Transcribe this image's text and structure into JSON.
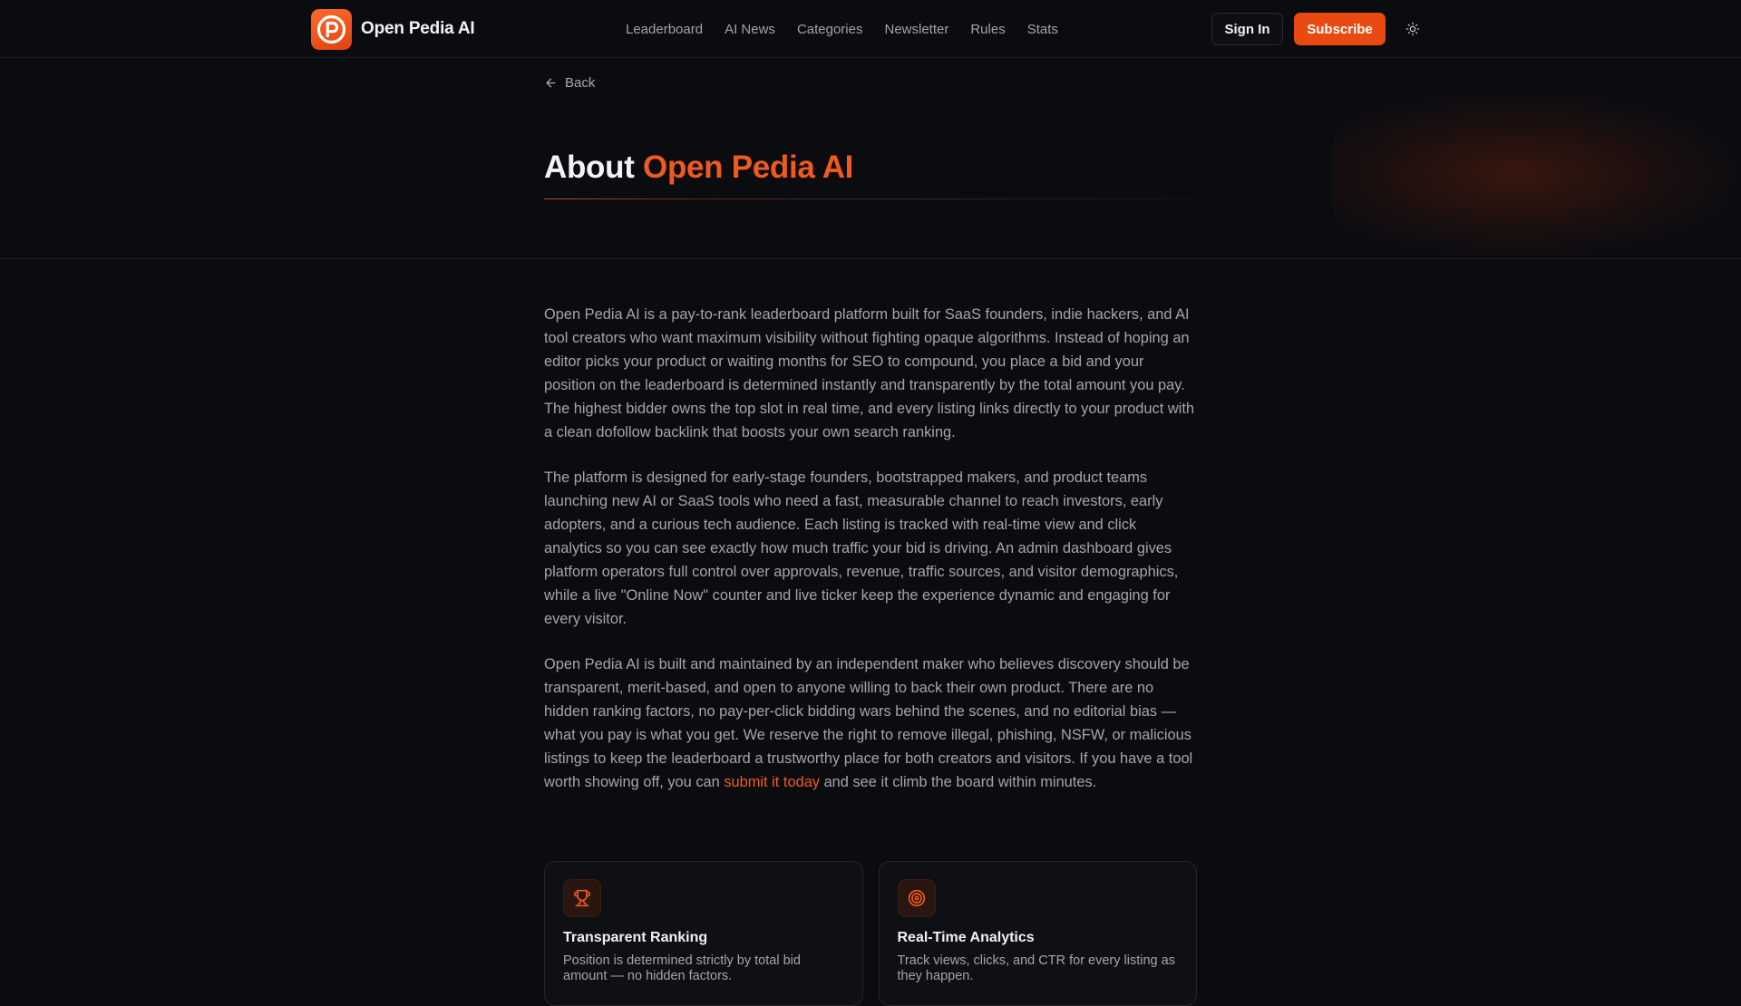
{
  "header": {
    "brand_name": "Open Pedia AI",
    "nav": [
      "Leaderboard",
      "AI News",
      "Categories",
      "Newsletter",
      "Rules",
      "Stats"
    ],
    "sign_in_label": "Sign In",
    "subscribe_label": "Subscribe",
    "theme_icon": "sun-icon"
  },
  "hero": {
    "back_label": "Back",
    "title_prefix": "About",
    "title_accent": "Open Pedia AI"
  },
  "content": {
    "paragraph_1": "Open Pedia AI is a pay-to-rank leaderboard platform built for SaaS founders, indie hackers, and AI tool creators who want maximum visibility without fighting opaque algorithms. Instead of hoping an editor picks your product or waiting months for SEO to compound, you place a bid and your position on the leaderboard is determined instantly and transparently by the total amount you pay. The highest bidder owns the top slot in real time, and every listing links directly to your product with a clean dofollow backlink that boosts your own search ranking.",
    "paragraph_2": "The platform is designed for early-stage founders, bootstrapped makers, and product teams launching new AI or SaaS tools who need a fast, measurable channel to reach investors, early adopters, and a curious tech audience. Each listing is tracked with real-time view and click analytics so you can see exactly how much traffic your bid is driving. An admin dashboard gives platform operators full control over approvals, revenue, traffic sources, and visitor demographics, while a live \"Online Now\" counter and live ticker keep the experience dynamic and engaging for every visitor.",
    "paragraph_3_before_link": "Open Pedia AI is built and maintained by an independent maker who believes discovery should be transparent, merit-based, and open to anyone willing to back their own product. There are no hidden ranking factors, no pay-per-click bidding wars behind the scenes, and no editorial bias — what you pay is what you get. We reserve the right to remove illegal, phishing, NSFW, or malicious listings to keep the leaderboard a trustworthy place for both creators and visitors. If you have a tool worth showing off, you can ",
    "paragraph_3_link": "submit it today",
    "paragraph_3_after_link": " and see it climb the board within minutes."
  },
  "cards": [
    {
      "icon": "trophy-icon",
      "title": "Transparent Ranking",
      "description": "Position is determined strictly by total bid amount — no hidden factors."
    },
    {
      "icon": "target-icon",
      "title": "Real-Time Analytics",
      "description": "Track views, clicks, and CTR for every listing as they happen."
    }
  ],
  "colors": {
    "accent": "#ea4a12",
    "accent_text": "#f05a1e",
    "background": "#0b0c10",
    "body_text": "#a3a5ad"
  }
}
